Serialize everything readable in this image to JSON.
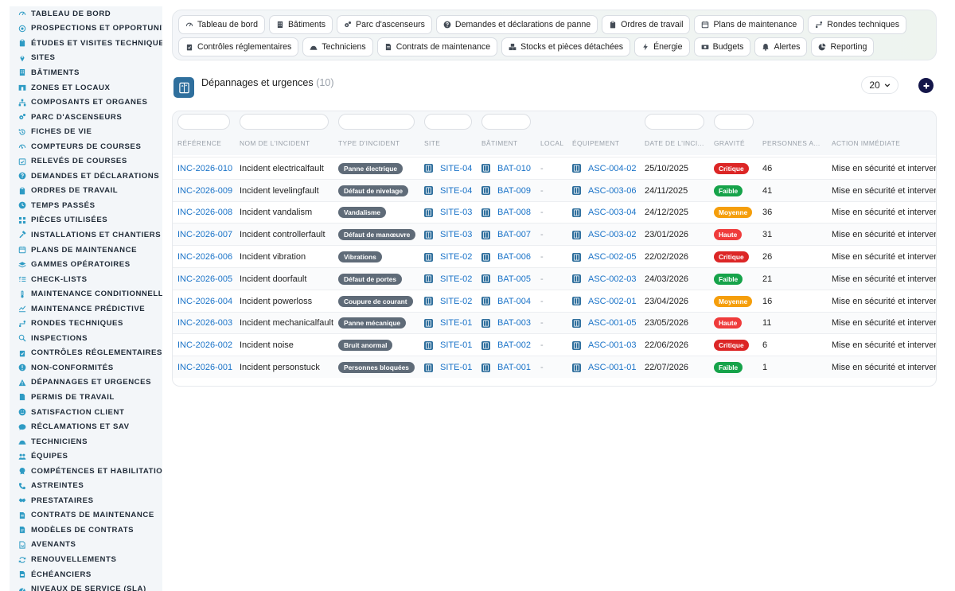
{
  "colors": {
    "sidebar_icon": "#2e9bc4",
    "nav_icon": "#444c56",
    "link": "#1a73c8",
    "entity_icon": "#2f6f9d",
    "type_badge": "#5f6b78",
    "add_button": "#14164a",
    "sev_critique": "#dc2626",
    "sev_faible": "#16a34a",
    "sev_moyenne": "#f59e0b",
    "sev_haute": "#ef3b3b"
  },
  "sidebar": {
    "items": [
      {
        "label": "TABLEAU DE BORD",
        "icon": "gauge-icon"
      },
      {
        "label": "PROSPECTIONS ET OPPORTUNITÉS",
        "icon": "target-icon"
      },
      {
        "label": "ÉTUDES ET VISITES TECHNIQUES",
        "icon": "clipboard-icon"
      },
      {
        "label": "SITES",
        "icon": "map-pin-icon"
      },
      {
        "label": "BÂTIMENTS",
        "icon": "building-icon"
      },
      {
        "label": "ZONES ET LOCAUX",
        "icon": "door-icon"
      },
      {
        "label": "COMPOSANTS ET ORGANES",
        "icon": "sitemap-icon"
      },
      {
        "label": "PARC D'ASCENSEURS",
        "icon": "cogs-icon"
      },
      {
        "label": "FICHES DE VIE",
        "icon": "history-icon"
      },
      {
        "label": "COMPTEURS DE COURSES",
        "icon": "counter-icon"
      },
      {
        "label": "RELEVÉS DE COURSES",
        "icon": "calendar-check-icon"
      },
      {
        "label": "DEMANDES ET DÉCLARATIONS",
        "icon": "question-icon"
      },
      {
        "label": "ORDRES DE TRAVAIL",
        "icon": "clipboard-icon"
      },
      {
        "label": "TEMPS PASSÉS",
        "icon": "clock-icon"
      },
      {
        "label": "PIÈCES UTILISÉES",
        "icon": "parts-icon"
      },
      {
        "label": "INSTALLATIONS ET CHANTIERS",
        "icon": "hammer-icon"
      },
      {
        "label": "PLANS DE MAINTENANCE",
        "icon": "calendar-icon"
      },
      {
        "label": "GAMMES OPÉRATOIRES",
        "icon": "layers-icon"
      },
      {
        "label": "CHECK-LISTS",
        "icon": "list-check-icon"
      },
      {
        "label": "MAINTENANCE CONDITIONNELLE",
        "icon": "thermometer-icon"
      },
      {
        "label": "MAINTENANCE PRÉDICTIVE",
        "icon": "chart-line-icon"
      },
      {
        "label": "RONDES TECHNIQUES",
        "icon": "route-icon"
      },
      {
        "label": "INSPECTIONS",
        "icon": "search-icon"
      },
      {
        "label": "CONTRÔLES RÉGLEMENTAIRES",
        "icon": "clipboard-check-icon"
      },
      {
        "label": "NON-CONFORMITÉS",
        "icon": "exclamation-circle-icon"
      },
      {
        "label": "DÉPANNAGES ET URGENCES",
        "icon": "warning-triangle-icon"
      },
      {
        "label": "PERMIS DE TRAVAIL",
        "icon": "file-icon"
      },
      {
        "label": "SATISFACTION CLIENT",
        "icon": "smile-icon"
      },
      {
        "label": "RÉCLAMATIONS ET SAV",
        "icon": "comment-icon"
      },
      {
        "label": "TECHNICIENS",
        "icon": "hard-hat-icon"
      },
      {
        "label": "ÉQUIPES",
        "icon": "users-icon"
      },
      {
        "label": "COMPÉTENCES ET HABILITATIONS",
        "icon": "certificate-icon"
      },
      {
        "label": "ASTREINTES",
        "icon": "phone-icon"
      },
      {
        "label": "PRESTATAIRES",
        "icon": "handshake-icon"
      },
      {
        "label": "CONTRATS DE MAINTENANCE",
        "icon": "file-contract-icon"
      },
      {
        "label": "MODÈLES DE CONTRATS",
        "icon": "file-alt-icon"
      },
      {
        "label": "AVENANTS",
        "icon": "file-signature-icon"
      },
      {
        "label": "RENOUVELLEMENTS",
        "icon": "sync-icon"
      },
      {
        "label": "ÉCHÉANCIERS",
        "icon": "file-invoice-icon"
      },
      {
        "label": "NIVEAUX DE SERVICE (SLA)",
        "icon": "tachometer-icon"
      }
    ]
  },
  "topnav": {
    "row1": [
      {
        "label": "Tableau de bord",
        "icon": "gauge-icon"
      },
      {
        "label": "Bâtiments",
        "icon": "building-icon"
      },
      {
        "label": "Parc d'ascenseurs",
        "icon": "cogs-icon"
      },
      {
        "label": "Demandes et déclarations de panne",
        "icon": "question-icon"
      },
      {
        "label": "Ordres de travail",
        "icon": "clipboard-icon"
      },
      {
        "label": "Plans de maintenance",
        "icon": "calendar-icon"
      },
      {
        "label": "Rondes techniques",
        "icon": "route-icon"
      }
    ],
    "row2": [
      {
        "label": "Contrôles réglementaires",
        "icon": "clipboard-check-icon"
      },
      {
        "label": "Techniciens",
        "icon": "hard-hat-icon"
      },
      {
        "label": "Contrats de maintenance",
        "icon": "file-contract-icon"
      },
      {
        "label": "Stocks et pièces détachées",
        "icon": "boxes-icon"
      },
      {
        "label": "Énergie",
        "icon": "bolt-icon"
      },
      {
        "label": "Budgets",
        "icon": "money-icon"
      },
      {
        "label": "Alertes",
        "icon": "bell-icon"
      },
      {
        "label": "Reporting",
        "icon": "pie-chart-icon"
      }
    ]
  },
  "page": {
    "title": "Dépannages et urgences",
    "count": "(10)",
    "page_size": "20"
  },
  "table": {
    "columns": [
      {
        "key": "ref",
        "label": "RÉFÉRENCE"
      },
      {
        "key": "name",
        "label": "NOM DE L'INCIDENT"
      },
      {
        "key": "type",
        "label": "TYPE D'INCIDENT"
      },
      {
        "key": "site",
        "label": "SITE"
      },
      {
        "key": "batiment",
        "label": "BÂTIMENT"
      },
      {
        "key": "local",
        "label": "LOCAL"
      },
      {
        "key": "equipement",
        "label": "ÉQUIPEMENT"
      },
      {
        "key": "date",
        "label": "DATE DE L'INCI..."
      },
      {
        "key": "gravite",
        "label": "GRAVITÉ"
      },
      {
        "key": "personnes",
        "label": "PERSONNES A..."
      },
      {
        "key": "action",
        "label": "ACTION IMMÉDIATE"
      }
    ],
    "rows": [
      {
        "ref": "INC-2026-010",
        "name": "Incident electricalfault",
        "type": "Panne électrique",
        "site": "SITE-04",
        "batiment": "BAT-010",
        "local": "-",
        "equipement": "ASC-004-02",
        "date": "25/10/2025",
        "gravite": "Critique",
        "personnes": "46",
        "action": "Mise en sécurité et intervention"
      },
      {
        "ref": "INC-2026-009",
        "name": "Incident levelingfault",
        "type": "Défaut de nivelage",
        "site": "SITE-04",
        "batiment": "BAT-009",
        "local": "-",
        "equipement": "ASC-003-06",
        "date": "24/11/2025",
        "gravite": "Faible",
        "personnes": "41",
        "action": "Mise en sécurité et intervention"
      },
      {
        "ref": "INC-2026-008",
        "name": "Incident vandalism",
        "type": "Vandalisme",
        "site": "SITE-03",
        "batiment": "BAT-008",
        "local": "-",
        "equipement": "ASC-003-04",
        "date": "24/12/2025",
        "gravite": "Moyenne",
        "personnes": "36",
        "action": "Mise en sécurité et intervention"
      },
      {
        "ref": "INC-2026-007",
        "name": "Incident controllerfault",
        "type": "Défaut de manœuvre",
        "site": "SITE-03",
        "batiment": "BAT-007",
        "local": "-",
        "equipement": "ASC-003-02",
        "date": "23/01/2026",
        "gravite": "Haute",
        "personnes": "31",
        "action": "Mise en sécurité et intervention"
      },
      {
        "ref": "INC-2026-006",
        "name": "Incident vibration",
        "type": "Vibrations",
        "site": "SITE-02",
        "batiment": "BAT-006",
        "local": "-",
        "equipement": "ASC-002-05",
        "date": "22/02/2026",
        "gravite": "Critique",
        "personnes": "26",
        "action": "Mise en sécurité et intervention"
      },
      {
        "ref": "INC-2026-005",
        "name": "Incident doorfault",
        "type": "Défaut de portes",
        "site": "SITE-02",
        "batiment": "BAT-005",
        "local": "-",
        "equipement": "ASC-002-03",
        "date": "24/03/2026",
        "gravite": "Faible",
        "personnes": "21",
        "action": "Mise en sécurité et intervention"
      },
      {
        "ref": "INC-2026-004",
        "name": "Incident powerloss",
        "type": "Coupure de courant",
        "site": "SITE-02",
        "batiment": "BAT-004",
        "local": "-",
        "equipement": "ASC-002-01",
        "date": "23/04/2026",
        "gravite": "Moyenne",
        "personnes": "16",
        "action": "Mise en sécurité et intervention"
      },
      {
        "ref": "INC-2026-003",
        "name": "Incident mechanicalfault",
        "type": "Panne mécanique",
        "site": "SITE-01",
        "batiment": "BAT-003",
        "local": "-",
        "equipement": "ASC-001-05",
        "date": "23/05/2026",
        "gravite": "Haute",
        "personnes": "11",
        "action": "Mise en sécurité et intervention"
      },
      {
        "ref": "INC-2026-002",
        "name": "Incident noise",
        "type": "Bruit anormal",
        "site": "SITE-01",
        "batiment": "BAT-002",
        "local": "-",
        "equipement": "ASC-001-03",
        "date": "22/06/2026",
        "gravite": "Critique",
        "personnes": "6",
        "action": "Mise en sécurité et intervention"
      },
      {
        "ref": "INC-2026-001",
        "name": "Incident personstuck",
        "type": "Personnes bloquées",
        "site": "SITE-01",
        "batiment": "BAT-001",
        "local": "-",
        "equipement": "ASC-001-01",
        "date": "22/07/2026",
        "gravite": "Faible",
        "personnes": "1",
        "action": "Mise en sécurité et intervention"
      }
    ]
  }
}
